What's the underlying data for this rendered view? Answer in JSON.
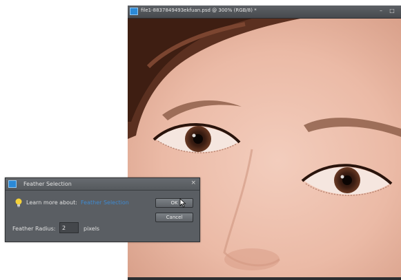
{
  "document": {
    "title": "file1-8837849493ekfuan.psd @ 300% (RGB/8) *",
    "minimize_glyph": "–",
    "restore_glyph": "□",
    "icon": "photoshop-elements-icon"
  },
  "dialog": {
    "title": "Feather Selection",
    "close_glyph": "×",
    "learn_more_text": "Learn more about:",
    "learn_more_link": "Feather Selection",
    "ok_label": "OK",
    "cancel_label": "Cancel",
    "radius_label": "Feather Radius:",
    "radius_value": "2",
    "radius_unit": "pixels",
    "icons": [
      "lightbulb-icon",
      "photoshop-elements-icon",
      "pointer-cursor-icon"
    ]
  },
  "colors": {
    "ui_dark": "#3c3f43",
    "dialog_bg": "#5a5e63",
    "link": "#3f8ad0",
    "skin": "#e9b9a6",
    "hair": "#5b3020"
  }
}
